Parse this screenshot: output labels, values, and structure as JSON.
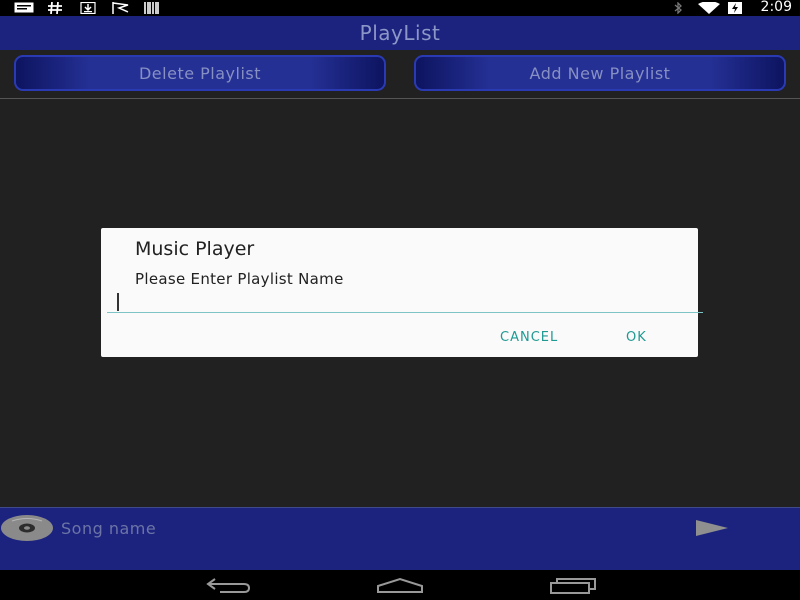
{
  "status_bar": {
    "time": "2:09",
    "left_icons": [
      "message-icon",
      "hash-icon",
      "download-icon",
      "flag-icon",
      "barcode-icon"
    ],
    "right_icons": [
      "bluetooth-icon",
      "wifi-icon",
      "battery-charging-icon"
    ]
  },
  "header": {
    "title": "PlayList"
  },
  "buttons": {
    "delete_label": "Delete Playlist",
    "add_label": "Add New Playlist"
  },
  "dialog": {
    "title": "Music Player",
    "message": "Please Enter Playlist Name",
    "input_value": "",
    "cancel_label": "CANCEL",
    "ok_label": "OK"
  },
  "player": {
    "song_placeholder": "Song name",
    "disc_icon": "disc-icon",
    "play_icon": "play-icon"
  },
  "nav": {
    "icons": [
      "back-icon",
      "home-icon",
      "recents-icon"
    ]
  },
  "colors": {
    "accent_teal": "#1f9a93",
    "header_blue": "#1b237e",
    "background": "#212121"
  }
}
